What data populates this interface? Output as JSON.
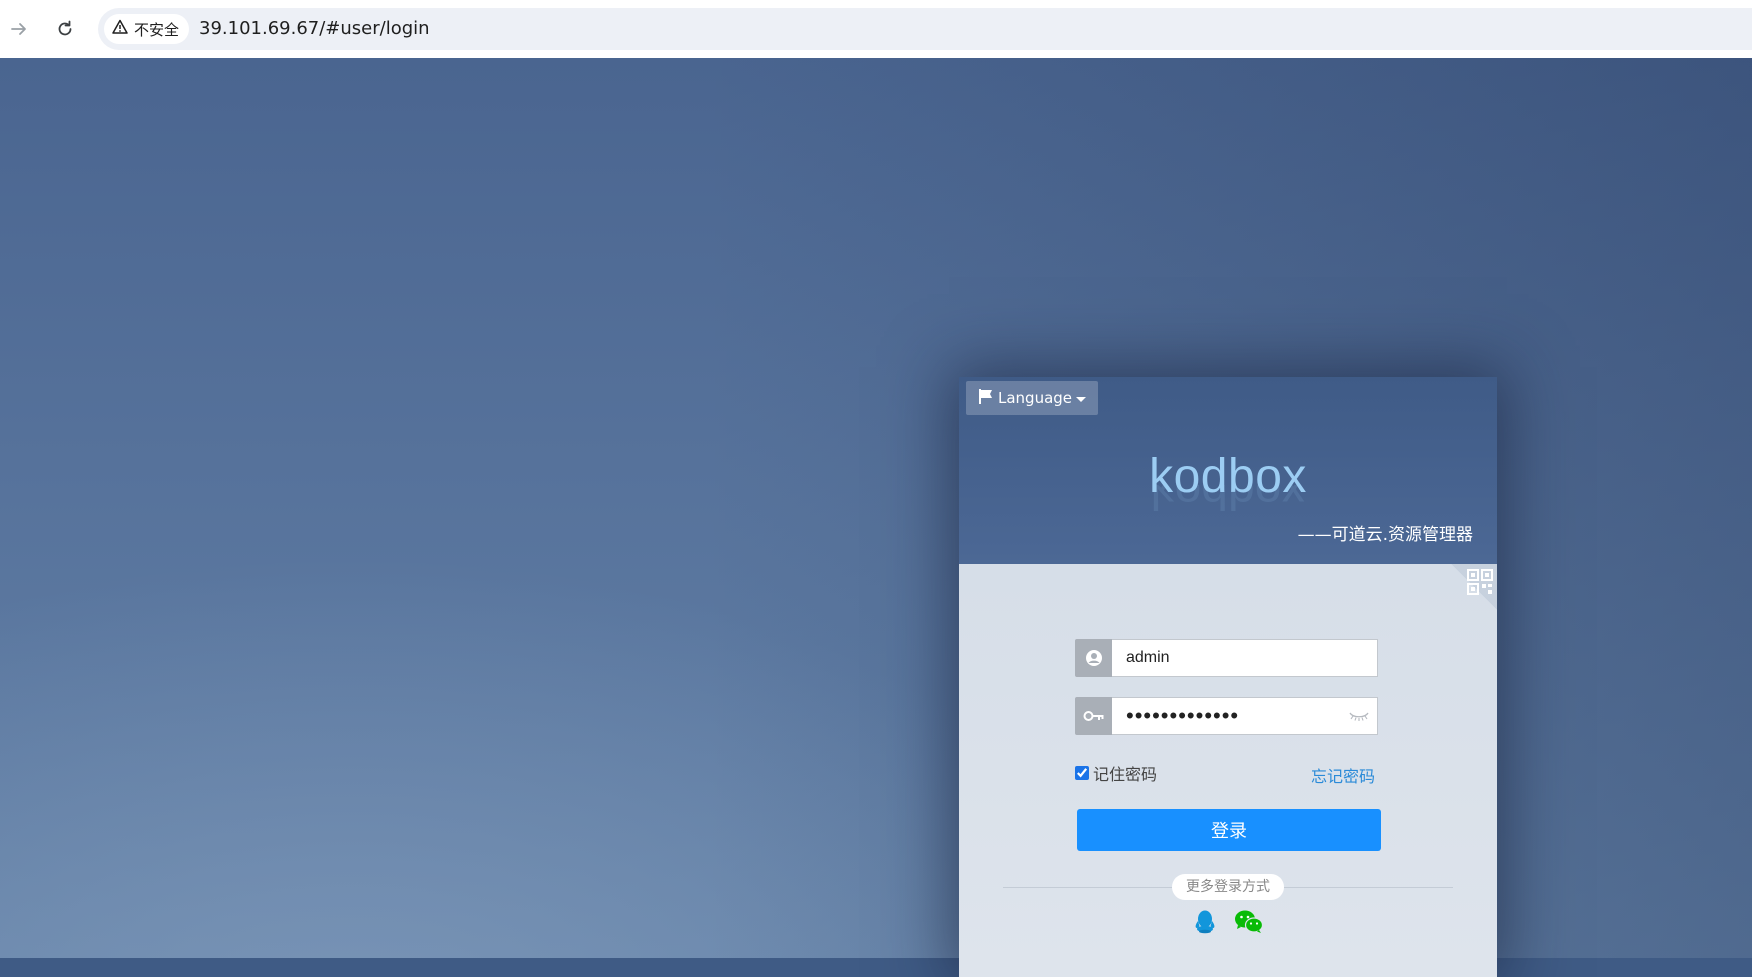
{
  "browser": {
    "security_label": "不安全",
    "url": "39.101.69.67/#user/login"
  },
  "login": {
    "language_label": "Language",
    "brand": "kodbox",
    "tagline": "——可道云.资源管理器",
    "username_value": "admin",
    "password_value": "•••••••••••••",
    "remember_label": "记住密码",
    "remember_checked": true,
    "forgot_label": "忘记密码",
    "submit_label": "登录",
    "more_methods_label": "更多登录方式"
  },
  "colors": {
    "accent": "#1890ff",
    "brand": "#9ccdf3",
    "qq": "#1296db",
    "wechat": "#09bb07"
  }
}
